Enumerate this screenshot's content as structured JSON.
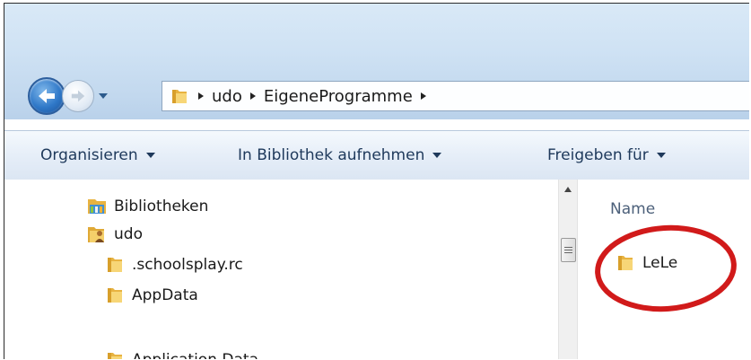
{
  "window": {
    "address_bar": {
      "crumbs": [
        "udo",
        "EigeneProgramme"
      ]
    }
  },
  "toolbar": {
    "organize_label": "Organisieren",
    "library_label": "In Bibliothek aufnehmen",
    "share_label": "Freigeben für"
  },
  "navigation": {
    "items": [
      {
        "label": "Bibliotheken",
        "icon": "library-icon"
      },
      {
        "label": "udo",
        "icon": "user-folder-icon"
      },
      {
        "label": ".schoolsplay.rc",
        "icon": "folder-icon"
      },
      {
        "label": "AppData",
        "icon": "folder-icon"
      },
      {
        "label": "Application Data",
        "icon": "folder-icon"
      }
    ]
  },
  "content": {
    "column_header": "Name",
    "items": [
      {
        "label": "LeLe",
        "icon": "folder-icon"
      }
    ]
  },
  "colors": {
    "annotation_circle": "#d11a1a",
    "folder": "#f2c55c",
    "toolbar_text": "#1e395b"
  }
}
